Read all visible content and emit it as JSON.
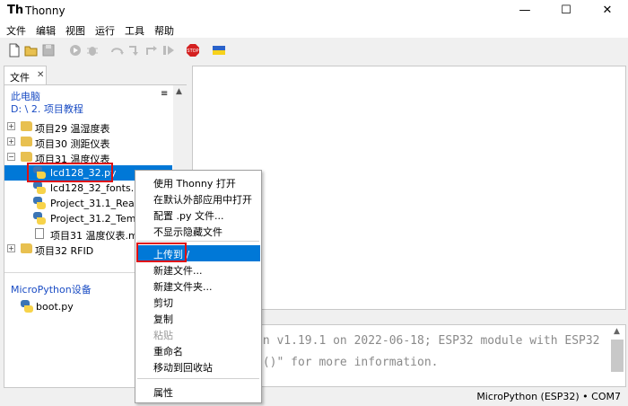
{
  "window": {
    "title": "Thonny",
    "minimize": "—",
    "maximize": "☐",
    "close": "✕"
  },
  "menu": [
    "文件",
    "编辑",
    "视图",
    "运行",
    "工具",
    "帮助"
  ],
  "toolbar": {
    "icons": [
      "new-file-icon",
      "open-file-icon",
      "save-icon",
      "run-icon",
      "debug-icon",
      "step-over-icon",
      "step-into-icon",
      "step-out-icon",
      "resume-icon",
      "stop-icon",
      "ukraine-flag-icon"
    ],
    "stop_label": "STOP",
    "colors": {
      "stop": "#d42020",
      "flag_blue": "#2a62c9",
      "flag_yellow": "#f7d21c"
    }
  },
  "files_tab": {
    "label": "文件",
    "close": "✕"
  },
  "file_browser": {
    "local_title": "此电脑",
    "local_path": "D: \\ 2. 项目教程",
    "menu_glyph": "≡",
    "scroll_up": "▲",
    "tree": [
      {
        "label": "项目29 温湿度表",
        "type": "folder",
        "expander": "+"
      },
      {
        "label": "项目30 测距仪表",
        "type": "folder",
        "expander": "+"
      },
      {
        "label": "项目31 温度仪表",
        "type": "folder",
        "expander": "−"
      },
      {
        "label": "lcd128_32.py",
        "type": "py",
        "selected": true
      },
      {
        "label": "lcd128_32_fonts.py",
        "type": "py"
      },
      {
        "label": "Project_31.1_Read_",
        "type": "py"
      },
      {
        "label": "Project_31.2_Temp",
        "type": "py"
      },
      {
        "label": "项目31 温度仪表.md",
        "type": "md"
      },
      {
        "label": "项目32 RFID",
        "type": "folder",
        "expander": "+"
      }
    ],
    "device_title": "MicroPython设备",
    "device_files": [
      {
        "label": "boot.py",
        "type": "py"
      }
    ]
  },
  "shell": {
    "lines": [
      "on v1.19.1 on 2022-06-18; ESP32 module with ESP32",
      "p()\" for more information."
    ],
    "scroll_up": "▲"
  },
  "context_menu": {
    "items": [
      {
        "label": "使用 Thonny 打开"
      },
      {
        "label": "在默认外部应用中打开"
      },
      {
        "label": "配置 .py 文件..."
      },
      {
        "label": "不显示隐藏文件"
      },
      {
        "label": "上传到 /",
        "highlighted": true
      },
      {
        "label": "新建文件..."
      },
      {
        "label": "新建文件夹..."
      },
      {
        "label": "剪切"
      },
      {
        "label": "复制"
      },
      {
        "label": "粘贴",
        "disabled": true
      },
      {
        "label": "重命名"
      },
      {
        "label": "移动到回收站"
      },
      {
        "label": "属性"
      }
    ]
  },
  "status": {
    "interpreter": "MicroPython (ESP32)  •  COM7"
  }
}
